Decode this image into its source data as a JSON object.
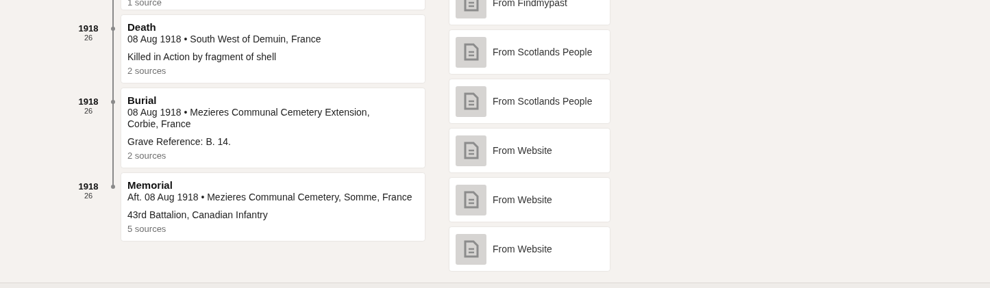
{
  "events": [
    {
      "sources": "1 source"
    },
    {
      "year": "1918",
      "age": "26",
      "title": "Death",
      "details": [
        "08 Aug 1918 • South West of Demuin, France"
      ],
      "description": "Killed in Action by fragment of shell",
      "sources": "2 sources"
    },
    {
      "year": "1918",
      "age": "26",
      "title": "Burial",
      "details": [
        "08 Aug 1918 • Mezieres Communal Cemetery Extension,",
        "Corbie, France"
      ],
      "description": "Grave Reference: B. 14.",
      "sources": "2 sources"
    },
    {
      "year": "1918",
      "age": "26",
      "title": "Memorial",
      "details": [
        "Aft. 08 Aug 1918 • Mezieres Communal Cemetery, Somme, France"
      ],
      "description": "43rd Battalion, Canadian Infantry",
      "sources": "5 sources"
    }
  ],
  "source_records": [
    {
      "label": "From Findmypast"
    },
    {
      "label": "From Scotlands People"
    },
    {
      "label": "From Scotlands People"
    },
    {
      "label": "From Website"
    },
    {
      "label": "From Website"
    },
    {
      "label": "From Website"
    }
  ]
}
